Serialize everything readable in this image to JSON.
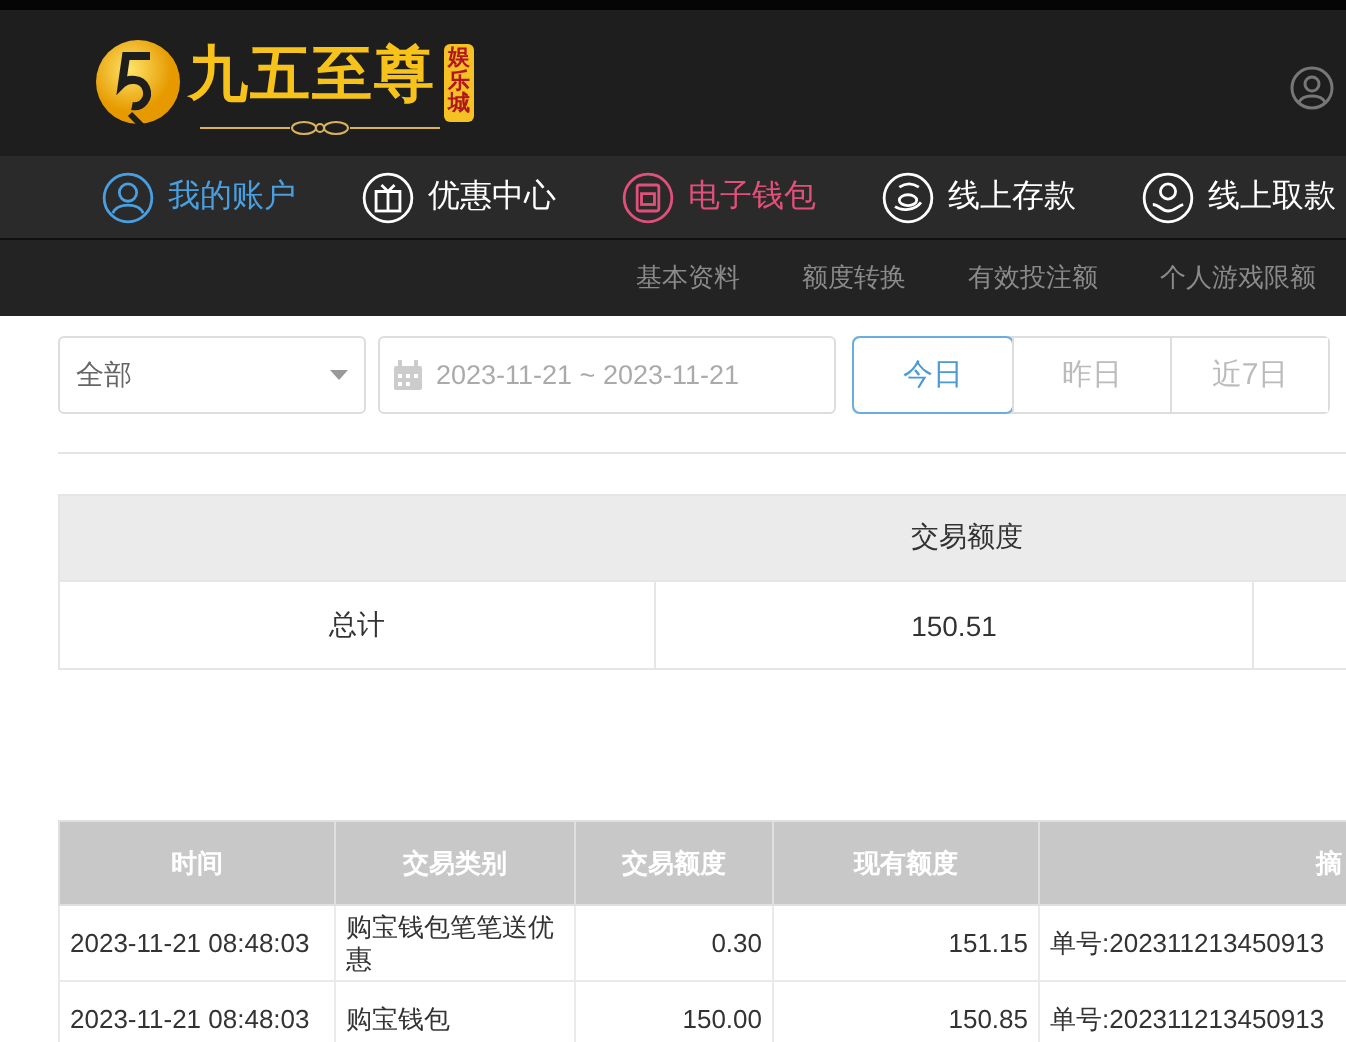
{
  "brand": {
    "name": "九五至尊",
    "tag": "娱乐城"
  },
  "main_nav": [
    {
      "label": "我的账户",
      "color": "#4a9fe0"
    },
    {
      "label": "优惠中心",
      "color": "#ffffff"
    },
    {
      "label": "电子钱包",
      "color": "#e0507a"
    },
    {
      "label": "线上存款",
      "color": "#ffffff"
    },
    {
      "label": "线上取款",
      "color": "#ffffff"
    }
  ],
  "sub_nav": [
    "基本资料",
    "额度转换",
    "有效投注额",
    "个人游戏限额"
  ],
  "filters": {
    "category": "全部",
    "date_range": "2023-11-21 ~ 2023-11-21",
    "quick_ranges": [
      {
        "label": "今日",
        "selected": true
      },
      {
        "label": "昨日",
        "selected": false
      },
      {
        "label": "近7日",
        "selected": false
      }
    ]
  },
  "summary": {
    "header": "交易额度",
    "rows": [
      {
        "label": "总计",
        "amount": "150.51"
      }
    ]
  },
  "transactions": {
    "columns": [
      "时间",
      "交易类别",
      "交易额度",
      "现有额度",
      "摘"
    ],
    "rows": [
      [
        "2023-11-21 08:48:03",
        "购宝钱包笔笔送优惠",
        "0.30",
        "151.15",
        "单号:202311213450913"
      ],
      [
        "2023-11-21 08:48:03",
        "购宝钱包",
        "150.00",
        "150.85",
        "单号:202311213450913"
      ]
    ]
  }
}
